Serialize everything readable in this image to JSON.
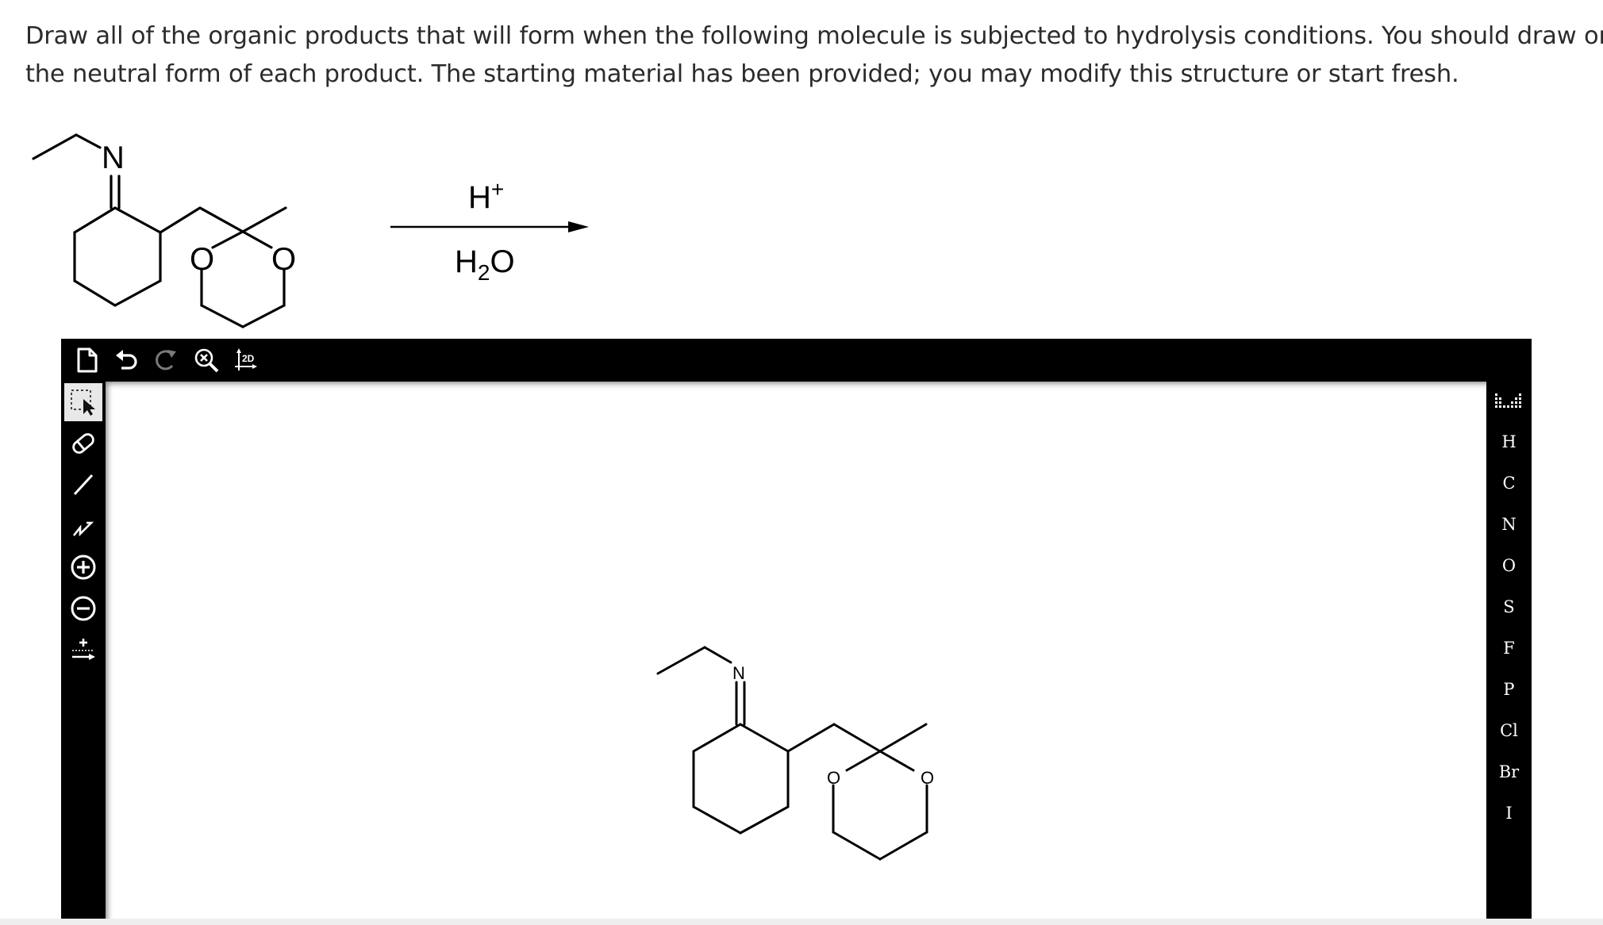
{
  "question": {
    "line1": "Draw all of the organic products that will form when the following molecule is subjected to hydrolysis conditions. You should draw only",
    "line2": "the neutral form of each product. The starting material has been provided; you may modify this structure or start fresh."
  },
  "reaction": {
    "reagent_top": "H",
    "reagent_top_sup": "+",
    "reagent_bottom_a": "H",
    "reagent_bottom_sub": "2",
    "reagent_bottom_b": "O"
  },
  "atoms": {
    "nitrogen": "N",
    "oxygen": "O"
  },
  "toolbar": {
    "zoom_2d_label": "2D"
  },
  "elements": [
    "H",
    "C",
    "N",
    "O",
    "S",
    "F",
    "P",
    "Cl",
    "Br",
    "I"
  ]
}
